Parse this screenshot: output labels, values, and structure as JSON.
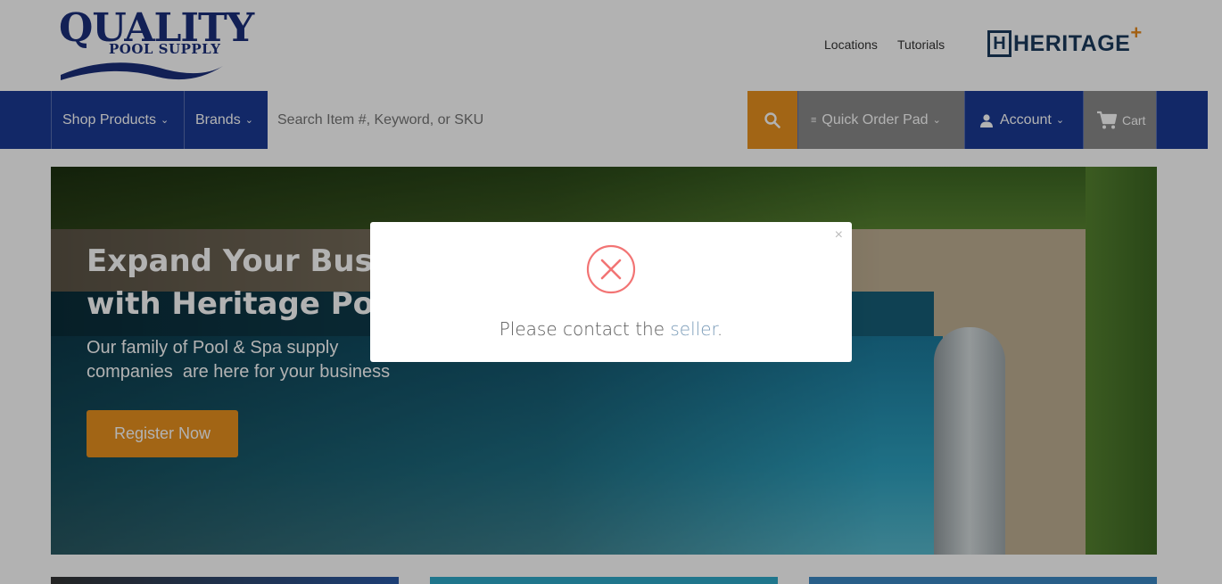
{
  "header": {
    "logo_line1": "QUALITY",
    "logo_line2": "POOL SUPPLY",
    "links": [
      "Locations",
      "Tutorials"
    ],
    "partner_logo_mark": "H",
    "partner_logo_text": "HERITAGE",
    "partner_logo_plus": "+"
  },
  "nav": {
    "shop_products": "Shop Products",
    "brands": "Brands",
    "search_placeholder": "Search Item #, Keyword, or SKU",
    "quick_order_pad": "Quick Order Pad",
    "account": "Account",
    "cart": "Cart",
    "icons": {
      "search": "search-icon",
      "account": "user-icon",
      "cart": "cart-icon",
      "chevron": "chevron-down-icon"
    }
  },
  "hero": {
    "title_line1": "Expand Your Busin",
    "title_line2": "with Heritage Pool",
    "subtitle_line1": "Our family of Pool & Spa supply",
    "subtitle_line2": "companies  are here for your business",
    "cta": "Register Now"
  },
  "modal": {
    "message_prefix": "Please contact the ",
    "link_text": "seller",
    "message_suffix": ".",
    "close": "×",
    "icon": "error-x-icon"
  },
  "colors": {
    "brand_blue": "#1b3a94",
    "accent_orange": "#e8911f",
    "nav_gray": "#8a8a8a",
    "error_red": "#f27474"
  }
}
